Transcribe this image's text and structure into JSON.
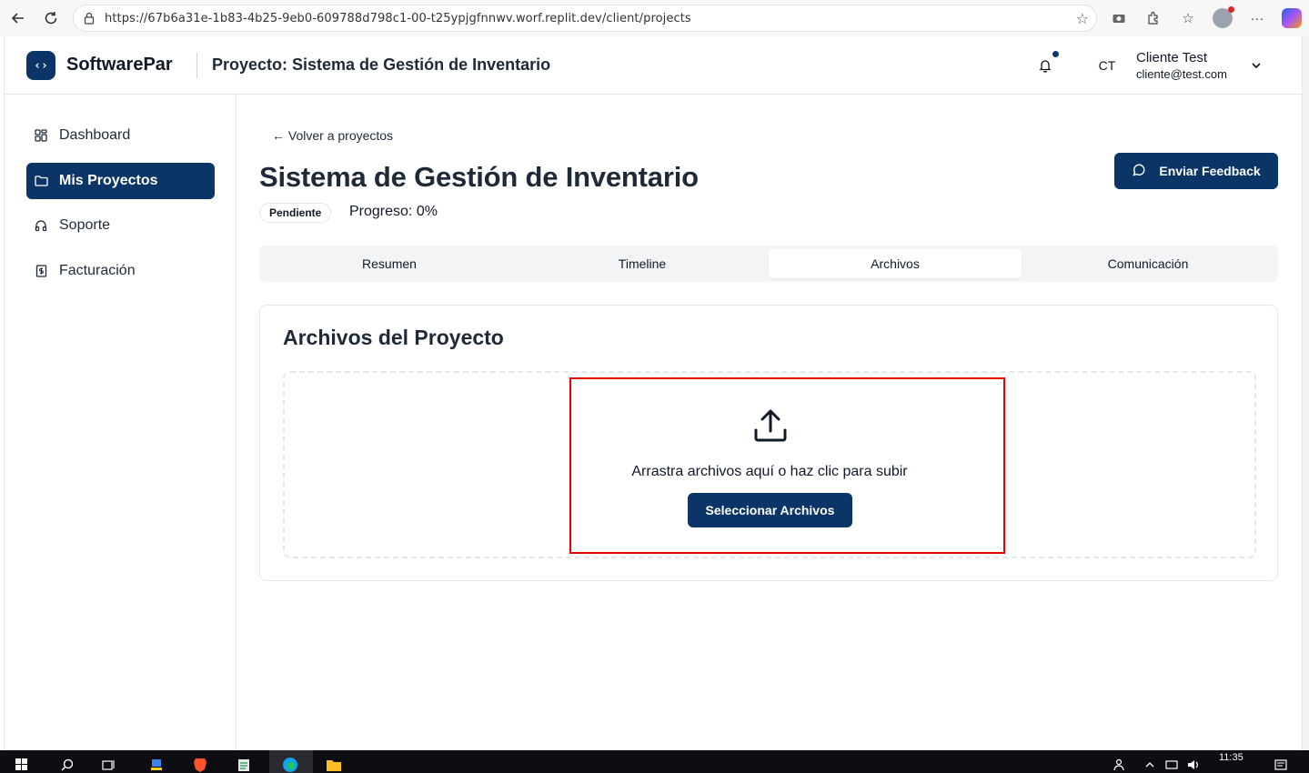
{
  "browser": {
    "url": "https://67b6a31e-1b83-4b25-9eb0-609788d798c1-00-t25ypjgfnnwv.worf.replit.dev/client/projects"
  },
  "header": {
    "brand": "SoftwarePar",
    "logo_icon": "code-icon",
    "title": "Proyecto: Sistema de Gestión de Inventario",
    "avatar_initials": "CT",
    "user_name": "Cliente Test",
    "user_email": "cliente@test.com"
  },
  "sidebar": {
    "items": [
      {
        "label": "Dashboard",
        "icon": "grid-icon"
      },
      {
        "label": "Mis Proyectos",
        "icon": "folder-icon"
      },
      {
        "label": "Soporte",
        "icon": "headphones-icon"
      },
      {
        "label": "Facturación",
        "icon": "receipt-icon"
      }
    ]
  },
  "main": {
    "back_link": "← Volver a proyectos",
    "title": "Sistema de Gestión de Inventario",
    "feedback_button": "Enviar Feedback",
    "status_badge": "Pendiente",
    "progress": "Progreso: 0%",
    "tabs": [
      {
        "label": "Resumen"
      },
      {
        "label": "Timeline"
      },
      {
        "label": "Archivos"
      },
      {
        "label": "Comunicación"
      }
    ],
    "active_tab": "Archivos"
  },
  "files_card": {
    "title": "Archivos del Proyecto",
    "drop_text": "Arrastra archivos aquí o haz clic para subir",
    "select_button": "Seleccionar Archivos"
  },
  "taskbar": {
    "clock": "11:35"
  },
  "colors": {
    "primary": "#0b3566",
    "highlight": "#e00000"
  }
}
